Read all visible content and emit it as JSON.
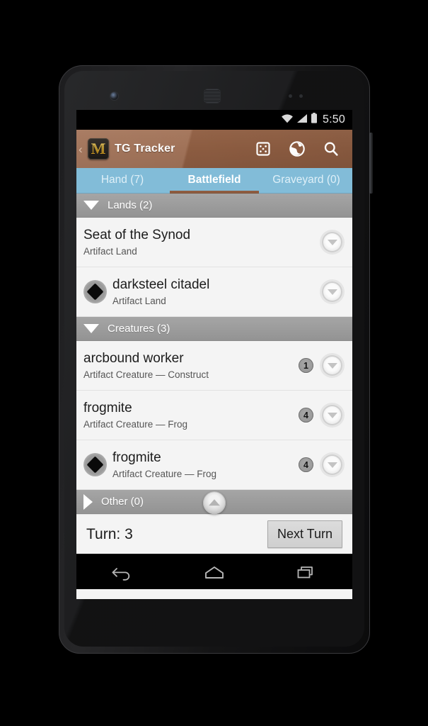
{
  "status_bar": {
    "clock": "5:50",
    "icons": [
      "wifi-icon",
      "cell-signal-icon",
      "battery-icon"
    ]
  },
  "action_bar": {
    "up_chevron": "‹",
    "logo_letter": "M",
    "title": "TG Tracker",
    "actions": [
      {
        "name": "dice-icon",
        "label": "Dice"
      },
      {
        "name": "tap-globe-icon",
        "label": "Tap"
      },
      {
        "name": "search-icon",
        "label": "Search"
      }
    ]
  },
  "tabs": [
    {
      "label": "Hand (7)",
      "active": false
    },
    {
      "label": "Battlefield",
      "active": true
    },
    {
      "label": "Graveyard (0)",
      "active": false
    }
  ],
  "sections": [
    {
      "label": "Lands (2)",
      "expanded": true,
      "rows": [
        {
          "name": "Seat of the Synod",
          "type": "Artifact Land",
          "tapped": false,
          "count": ""
        },
        {
          "name": "darksteel citadel",
          "type": "Artifact Land",
          "tapped": true,
          "count": ""
        }
      ]
    },
    {
      "label": "Creatures (3)",
      "expanded": true,
      "rows": [
        {
          "name": "arcbound worker",
          "type": "Artifact Creature  — Construct",
          "tapped": false,
          "count": "1"
        },
        {
          "name": "frogmite",
          "type": "Artifact Creature  — Frog",
          "tapped": false,
          "count": "4"
        },
        {
          "name": "frogmite",
          "type": "Artifact Creature  — Frog",
          "tapped": true,
          "count": "4"
        }
      ]
    },
    {
      "label": "Other (0)",
      "expanded": false,
      "rows": []
    }
  ],
  "turn_bar": {
    "turn_label": "Turn: 3",
    "next_turn_label": "Next Turn"
  },
  "nav_bar": {
    "buttons": [
      {
        "name": "back-nav-icon",
        "label": "Back"
      },
      {
        "name": "home-nav-icon",
        "label": "Home"
      },
      {
        "name": "recents-nav-icon",
        "label": "Recents"
      }
    ]
  },
  "colors": {
    "action_bar": "#956245",
    "tab_bar": "#82bcd8",
    "tab_indicator": "#8e5c40",
    "section_header": "#9b9b9b",
    "list_background": "#f4f4f4",
    "logo_gold": "#f3c13c"
  }
}
